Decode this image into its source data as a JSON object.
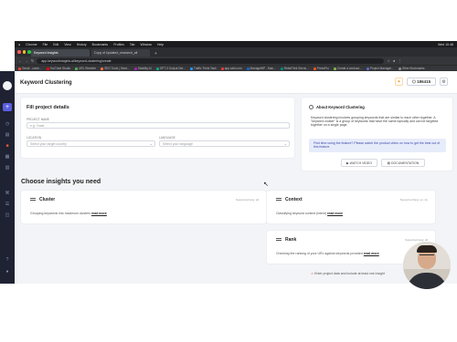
{
  "os_menu": {
    "items": [
      "Chrome",
      "File",
      "Edit",
      "View",
      "History",
      "Bookmarks",
      "Profiles",
      "Tab",
      "Window",
      "Help"
    ],
    "status": "Wed 10:48"
  },
  "browser": {
    "tabs": [
      {
        "title": "Keyword Insights",
        "active": true
      },
      {
        "title": "Copy of Updated_research_all",
        "active": false
      }
    ],
    "url": "app.keywordinsights.ai/keyword-clustering/create",
    "bookmarks": [
      "Gmail - conte...",
      "YouTube Studio",
      "URL Rewriter",
      "SEO Tools | Semr...",
      "Stability AI",
      "GPT-3 Output Det...",
      "Traffic Think Tank",
      "app.calir.com",
      "ManageWP - Man...",
      "RebelTrek Servic...",
      "PressPro",
      "Create a workout...",
      "Project Manager...",
      "Other Bookmarks"
    ]
  },
  "app": {
    "title": "Keyword Clustering",
    "credits": "186415",
    "coin_icon": "flame-icon",
    "settings_icon": "gear-icon"
  },
  "form": {
    "title": "Fill project details",
    "project_name_label": "PROJECT NAME",
    "project_name_placeholder": "e.g. Yoast",
    "location_label": "LOCATION",
    "location_placeholder": "Select your target country",
    "language_label": "LANGUAGE",
    "language_placeholder": "Select your language"
  },
  "about": {
    "title": "About Keyword Clustering",
    "description": "Keyword clustering involves grouping keywords that are similar to each other together. A \"keyword cluster\" is a group of keywords that have the same topically and can be targeted together on a single page.",
    "tip": "First time using the feature? Please watch the product video on how to get the best out of this feature.",
    "watch_video": "WATCH VIDEO",
    "documentation": "DOCUMENTATION"
  },
  "insights": {
    "heading": "Choose insights you need",
    "read_more": "read more",
    "items": [
      {
        "title": "Cluster",
        "langs": "Supported lang: all",
        "description": "Grouping keywords into maximum clusters"
      },
      {
        "title": "Context",
        "langs": "Supported lang: en, de",
        "description": "Classifying keyword context (intent)"
      },
      {
        "title": "Rank",
        "langs": "Supported lang: all",
        "description": "Checking the ranking of your URL against keywords provided"
      }
    ]
  },
  "footer": {
    "warning_icon": "warning-icon",
    "warning": "Enter project data and include at least one insight"
  },
  "colors": {
    "sidebar": "#1e2233",
    "accent": "#5a5fe0",
    "content_bg": "#f3f4f7",
    "warning": "#e04a3c"
  }
}
